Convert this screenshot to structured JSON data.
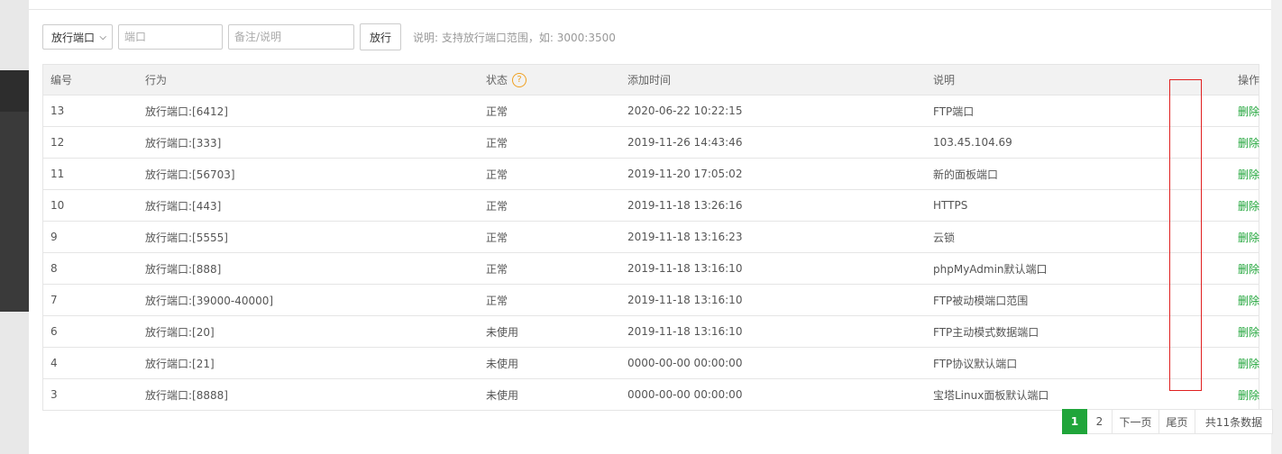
{
  "toolbar": {
    "select_value": "放行端口",
    "port_placeholder": "端口",
    "note_placeholder": "备注/说明",
    "submit_label": "放行",
    "tip": "说明: 支持放行端口范围，如: 3000:3500"
  },
  "table": {
    "headers": {
      "num": "编号",
      "action": "行为",
      "status": "状态",
      "time": "添加时间",
      "desc": "说明",
      "op": "操作"
    },
    "status_help_icon": "?",
    "rows": [
      {
        "num": "13",
        "action": "放行端口:[6412]",
        "status": "正常",
        "time": "2020-06-22 10:22:15",
        "desc": "FTP端口",
        "op": "删除"
      },
      {
        "num": "12",
        "action": "放行端口:[333]",
        "status": "正常",
        "time": "2019-11-26 14:43:46",
        "desc": "103.45.104.69",
        "op": "删除"
      },
      {
        "num": "11",
        "action": "放行端口:[56703]",
        "status": "正常",
        "time": "2019-11-20 17:05:02",
        "desc": "新的面板端口",
        "op": "删除"
      },
      {
        "num": "10",
        "action": "放行端口:[443]",
        "status": "正常",
        "time": "2019-11-18 13:26:16",
        "desc": "HTTPS",
        "op": "删除"
      },
      {
        "num": "9",
        "action": "放行端口:[5555]",
        "status": "正常",
        "time": "2019-11-18 13:16:23",
        "desc": "云锁",
        "op": "删除"
      },
      {
        "num": "8",
        "action": "放行端口:[888]",
        "status": "正常",
        "time": "2019-11-18 13:16:10",
        "desc": "phpMyAdmin默认端口",
        "op": "删除"
      },
      {
        "num": "7",
        "action": "放行端口:[39000-40000]",
        "status": "正常",
        "time": "2019-11-18 13:16:10",
        "desc": "FTP被动模端口范围",
        "op": "删除"
      },
      {
        "num": "6",
        "action": "放行端口:[20]",
        "status": "未使用",
        "time": "2019-11-18 13:16:10",
        "desc": "FTP主动模式数据端口",
        "op": "删除"
      },
      {
        "num": "4",
        "action": "放行端口:[21]",
        "status": "未使用",
        "time": "0000-00-00 00:00:00",
        "desc": "FTP协议默认端口",
        "op": "删除"
      },
      {
        "num": "3",
        "action": "放行端口:[8888]",
        "status": "未使用",
        "time": "0000-00-00 00:00:00",
        "desc": "宝塔Linux面板默认端口",
        "op": "删除"
      }
    ]
  },
  "pagination": {
    "pages": [
      "1",
      "2"
    ],
    "next": "下一页",
    "last": "尾页",
    "total": "共11条数据"
  },
  "colors": {
    "accent": "#20a53a",
    "help": "#f0a020",
    "highlight_box": "#e02020"
  }
}
